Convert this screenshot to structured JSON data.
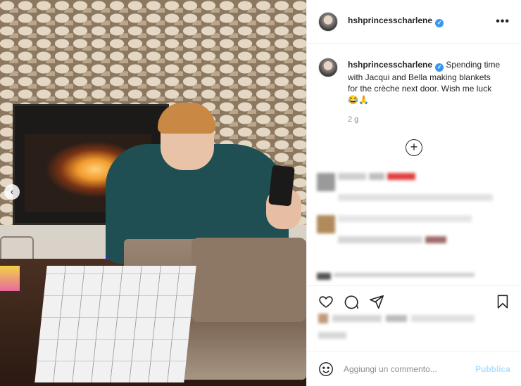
{
  "post": {
    "username": "hshprincesscharlene",
    "verified_glyph": "✓",
    "more_label": "•••",
    "caption_username": "hshprincesscharlene",
    "caption_text": "Spending time with Jacqui and Bella making blankets for the crèche next door. Wish me luck 😂🙏",
    "timestamp": "2 g",
    "load_more_label": "+",
    "carousel_prev_label": "‹"
  },
  "actions": {
    "like_icon": "heart-icon",
    "comment_icon": "comment-icon",
    "share_icon": "paper-plane-icon",
    "save_icon": "bookmark-icon"
  },
  "add_comment": {
    "placeholder": "Aggiungi un commento...",
    "publish_label": "Pubblica",
    "emoji_icon": "smiley-icon"
  },
  "colors": {
    "verified": "#3897f0",
    "publish_disabled": "#b2dffc",
    "muted": "#8e8e8e"
  }
}
